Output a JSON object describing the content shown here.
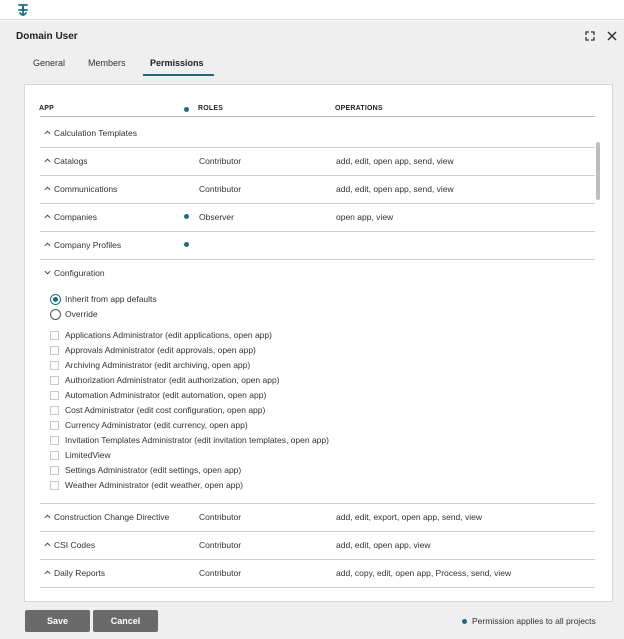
{
  "dialog": {
    "title": "Domain User",
    "tabs": [
      {
        "label": "General",
        "active": false
      },
      {
        "label": "Members",
        "active": false
      },
      {
        "label": "Permissions",
        "active": true
      }
    ]
  },
  "table": {
    "headers": {
      "app": "APP",
      "roles": "ROLES",
      "operations": "OPERATIONS"
    },
    "rows_top": [
      {
        "app": "Calculation Templates",
        "roles": "",
        "operations": "",
        "dot": false
      },
      {
        "app": "Catalogs",
        "roles": "Contributor",
        "operations": "add,  edit,  open app,  send,  view",
        "dot": false
      },
      {
        "app": "Communications",
        "roles": "Contributor",
        "operations": "add,  edit,  open app,  send,  view",
        "dot": false
      },
      {
        "app": "Companies",
        "roles": "Observer",
        "operations": "open app,  view",
        "dot": true
      },
      {
        "app": "Company Profiles",
        "roles": "",
        "operations": "",
        "dot": true
      }
    ],
    "expanded": {
      "app": "Configuration",
      "radio_options": [
        {
          "label": "Inherit from app defaults",
          "selected": true
        },
        {
          "label": "Override",
          "selected": false
        }
      ],
      "checkboxes": [
        "Applications Administrator (edit applications, open app)",
        "Approvals Administrator (edit approvals, open app)",
        "Archiving Administrator (edit archiving, open app)",
        "Authorization Administrator (edit authorization, open app)",
        "Automation Administrator (edit automation, open app)",
        "Cost Administrator (edit cost configuration, open app)",
        "Currency Administrator (edit currency, open app)",
        "Invitation Templates Administrator (edit invitation templates, open app)",
        "LimitedView",
        "Settings Administrator (edit settings, open app)",
        "Weather Administrator (edit weather, open app)"
      ]
    },
    "rows_bottom": [
      {
        "app": "Construction Change Directive",
        "roles": "Contributor",
        "operations": "add,  edit,  export,  open app,  send,  view",
        "dot": false
      },
      {
        "app": "CSI Codes",
        "roles": "Contributor",
        "operations": "add,  edit,  open app,  view",
        "dot": false
      },
      {
        "app": "Daily Reports",
        "roles": "Contributor",
        "operations": "add,  copy,  edit,  open app,  Process,  send,  view",
        "dot": false
      }
    ]
  },
  "footer": {
    "save_label": "Save",
    "cancel_label": "Cancel",
    "legend_text": "Permission applies to all projects"
  },
  "colors": {
    "accent": "#1d6b86",
    "button": "#6a6a6a",
    "dialog_bg": "#efefef"
  },
  "icons": [
    "app-logo-icon",
    "expand-icon",
    "close-icon",
    "chevron-up-icon",
    "chevron-down-icon",
    "global-permission-dot-icon"
  ]
}
